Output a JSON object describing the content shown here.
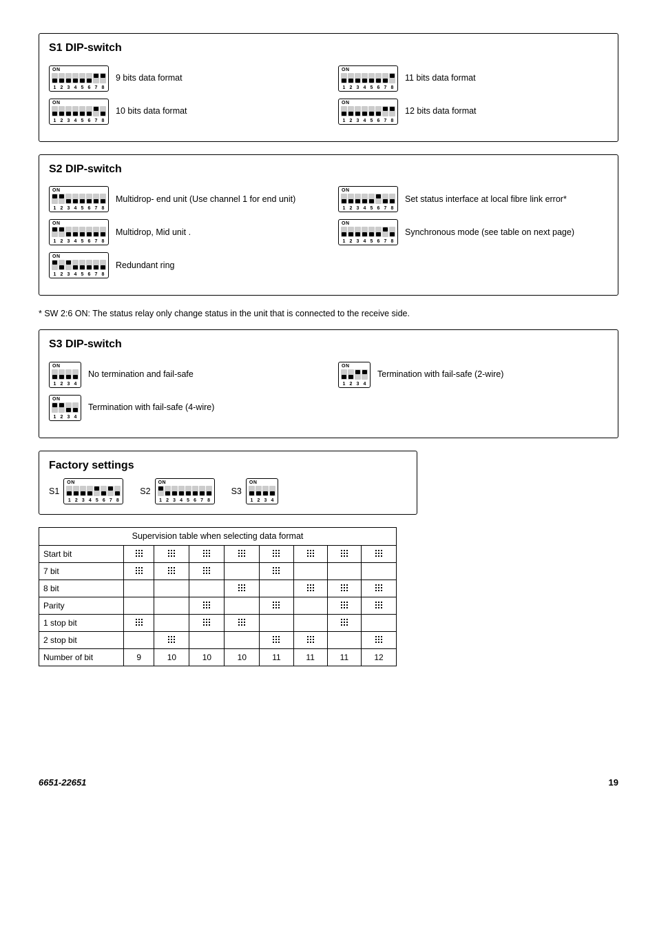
{
  "s1": {
    "title": "S1 DIP-switch",
    "items": [
      {
        "label": "9 bits data format",
        "switches": [
          0,
          0,
          0,
          0,
          0,
          0,
          1,
          1
        ],
        "size": 8
      },
      {
        "label": "10 bits data format",
        "switches": [
          0,
          0,
          0,
          0,
          0,
          0,
          1,
          0
        ],
        "size": 8
      },
      {
        "label": "11 bits data format",
        "switches": [
          0,
          0,
          0,
          0,
          0,
          0,
          0,
          1
        ],
        "size": 8
      },
      {
        "label": "12 bits data format",
        "switches": [
          0,
          0,
          0,
          0,
          0,
          0,
          1,
          1
        ],
        "render_override": [
          0,
          0,
          0,
          0,
          0,
          0,
          1,
          1
        ],
        "size": 8
      }
    ]
  },
  "s2": {
    "title": "S2 DIP-switch",
    "left": [
      {
        "label": "Multidrop- end unit (Use channel 1 for end unit)",
        "switches": [
          1,
          1,
          0,
          0,
          0,
          0,
          0,
          0
        ],
        "render": [
          1,
          1,
          0,
          0,
          0,
          0,
          0,
          0
        ],
        "custom": "endunit"
      },
      {
        "label": "Multidrop, Mid unit .",
        "switches": [
          1,
          1,
          0,
          0,
          0,
          0,
          0,
          0
        ]
      },
      {
        "label": "Redundant ring",
        "switches": [
          1,
          0,
          1,
          0,
          0,
          0,
          0,
          0
        ],
        "custom": "redundant"
      }
    ],
    "right": [
      {
        "label": "Set status interface at local fibre link error*",
        "switches": [
          0,
          0,
          0,
          0,
          0,
          1,
          0,
          0
        ]
      },
      {
        "label": "Synchronous mode (see table on next page)",
        "switches": [
          0,
          0,
          0,
          0,
          0,
          0,
          1,
          0
        ]
      }
    ]
  },
  "note": "* SW 2:6 ON: The status relay only change status in the unit that is connected to the receive side.",
  "s3": {
    "title": "S3 DIP-switch",
    "left": [
      {
        "label": "No termination and fail-safe",
        "switches": [
          0,
          0,
          0,
          0
        ]
      },
      {
        "label": "Termination with fail-safe (4-wire)",
        "switches": [
          1,
          1,
          0,
          0
        ]
      }
    ],
    "right": [
      {
        "label": "Termination with fail-safe (2-wire)",
        "switches": [
          0,
          0,
          1,
          1
        ],
        "custom": "2wire"
      }
    ]
  },
  "factory": {
    "title": "Factory settings",
    "s1_label": "S1",
    "s1": [
      0,
      0,
      0,
      0,
      1,
      0,
      1,
      0
    ],
    "s2_label": "S2",
    "s2": [
      1,
      0,
      0,
      0,
      0,
      0,
      0,
      0
    ],
    "s3_label": "S3",
    "s3": [
      0,
      0,
      0,
      0
    ]
  },
  "table": {
    "caption": "Supervision table when selecting data format",
    "rows": [
      {
        "label": "Start bit",
        "cells": [
          true,
          true,
          true,
          true,
          true,
          true,
          true,
          true
        ]
      },
      {
        "label": "7 bit",
        "cells": [
          true,
          true,
          true,
          false,
          true,
          false,
          false,
          false
        ]
      },
      {
        "label": "8 bit",
        "cells": [
          false,
          false,
          false,
          true,
          false,
          true,
          true,
          true
        ]
      },
      {
        "label": "Parity",
        "cells": [
          false,
          false,
          true,
          false,
          true,
          false,
          true,
          true
        ]
      },
      {
        "label": "1 stop bit",
        "cells": [
          true,
          false,
          true,
          true,
          false,
          false,
          true,
          false
        ]
      },
      {
        "label": "2 stop bit",
        "cells": [
          false,
          true,
          false,
          false,
          true,
          true,
          false,
          true
        ]
      },
      {
        "label": "Number of bit",
        "cells": [
          "9",
          "10",
          "10",
          "10",
          "11",
          "11",
          "11",
          "12"
        ]
      }
    ]
  },
  "footer": {
    "left": "6651-22651",
    "right": "19"
  }
}
